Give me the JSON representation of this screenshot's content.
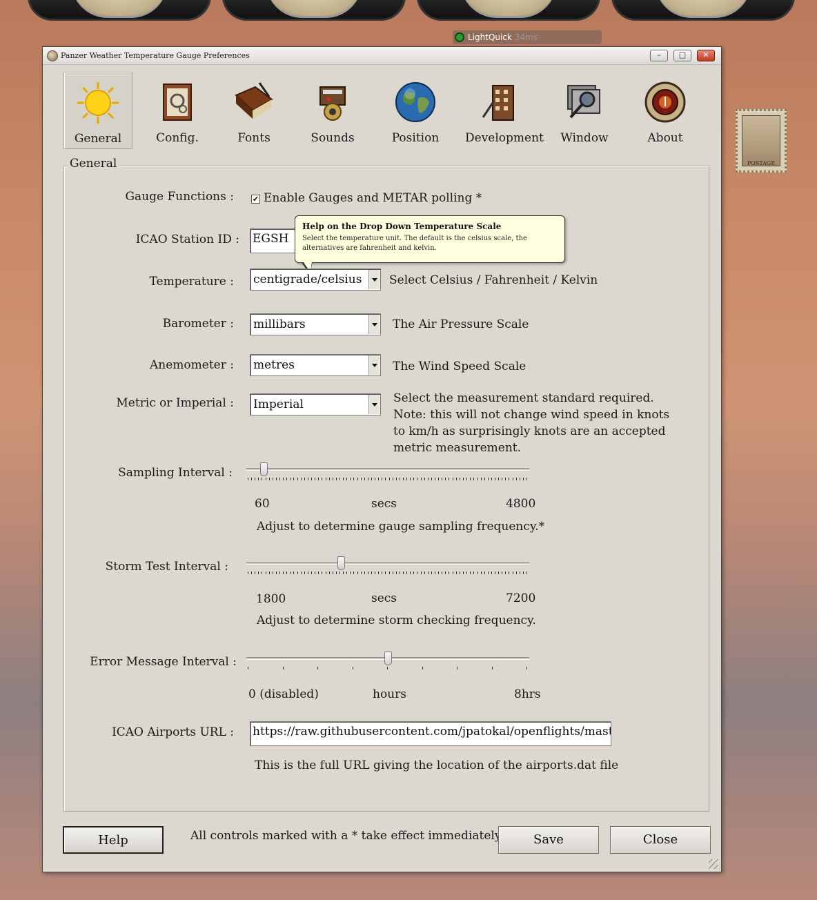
{
  "desktop": {
    "lightquick": {
      "name": "LightQuick",
      "time": "34ms"
    },
    "stamp_text": "POSTAGE"
  },
  "window": {
    "title": "Panzer Weather Temperature Gauge Preferences",
    "controls": {
      "minimize": "–",
      "maximize": "□",
      "close": "✕"
    }
  },
  "toolbar": {
    "items": [
      {
        "label": "General",
        "icon": "sun-icon",
        "active": true
      },
      {
        "label": "Config.",
        "icon": "clipboard-gears-icon",
        "active": false
      },
      {
        "label": "Fonts",
        "icon": "book-pen-icon",
        "active": false
      },
      {
        "label": "Sounds",
        "icon": "speaker-machine-icon",
        "active": false
      },
      {
        "label": "Position",
        "icon": "globe-icon",
        "active": false
      },
      {
        "label": "Development",
        "icon": "building-icon",
        "active": false
      },
      {
        "label": "Window",
        "icon": "magnifier-window-icon",
        "active": false
      },
      {
        "label": "About",
        "icon": "brass-gauge-icon",
        "active": false
      }
    ]
  },
  "general": {
    "group_label": "General",
    "gauge_functions": {
      "label": "Gauge Functions :",
      "checkbox_label": "Enable Gauges and METAR polling *",
      "checked": true
    },
    "icao_station": {
      "label": "ICAO Station ID :",
      "value": "EGSH"
    },
    "tooltip": {
      "title": "Help on the Drop Down Temperature Scale",
      "body": "Select the temperature unit. The default is the celsius scale, the alternatives are fahrenheit and kelvin."
    },
    "temperature": {
      "label": "Temperature :",
      "value": "centigrade/celsius",
      "hint": "Select Celsius / Fahrenheit / Kelvin"
    },
    "barometer": {
      "label": "Barometer :",
      "value": "millibars",
      "hint": "The Air Pressure Scale"
    },
    "anemometer": {
      "label": "Anemometer :",
      "value": "metres",
      "hint": "The Wind Speed Scale"
    },
    "metric": {
      "label": "Metric or Imperial :",
      "value": "Imperial",
      "hint_lines": [
        "Select the measurement standard required.",
        "Note: this will not change wind speed in knots",
        "to km/h as surprisingly knots are an accepted",
        "metric measurement."
      ]
    },
    "sampling": {
      "label": "Sampling Interval :",
      "min": "60",
      "unit": "secs",
      "max": "4800",
      "position": 0.05,
      "hint": "Adjust to determine gauge sampling frequency.*"
    },
    "storm": {
      "label": "Storm Test Interval :",
      "min": "1800",
      "unit": "secs",
      "max": "7200",
      "position": 0.33,
      "hint": "Adjust to determine storm checking frequency."
    },
    "error": {
      "label": "Error Message Interval :",
      "min": "0 (disabled)",
      "unit": "hours",
      "max": "8hrs",
      "position": 0.5
    },
    "airports": {
      "label": "ICAO Airports URL :",
      "value": "https://raw.githubusercontent.com/jpatokal/openflights/master/data/",
      "hint": "This is the full URL giving the location of the airports.dat file"
    }
  },
  "footer": {
    "help": "Help",
    "note": "All controls marked with a * take effect immediately.",
    "save": "Save",
    "close": "Close"
  }
}
